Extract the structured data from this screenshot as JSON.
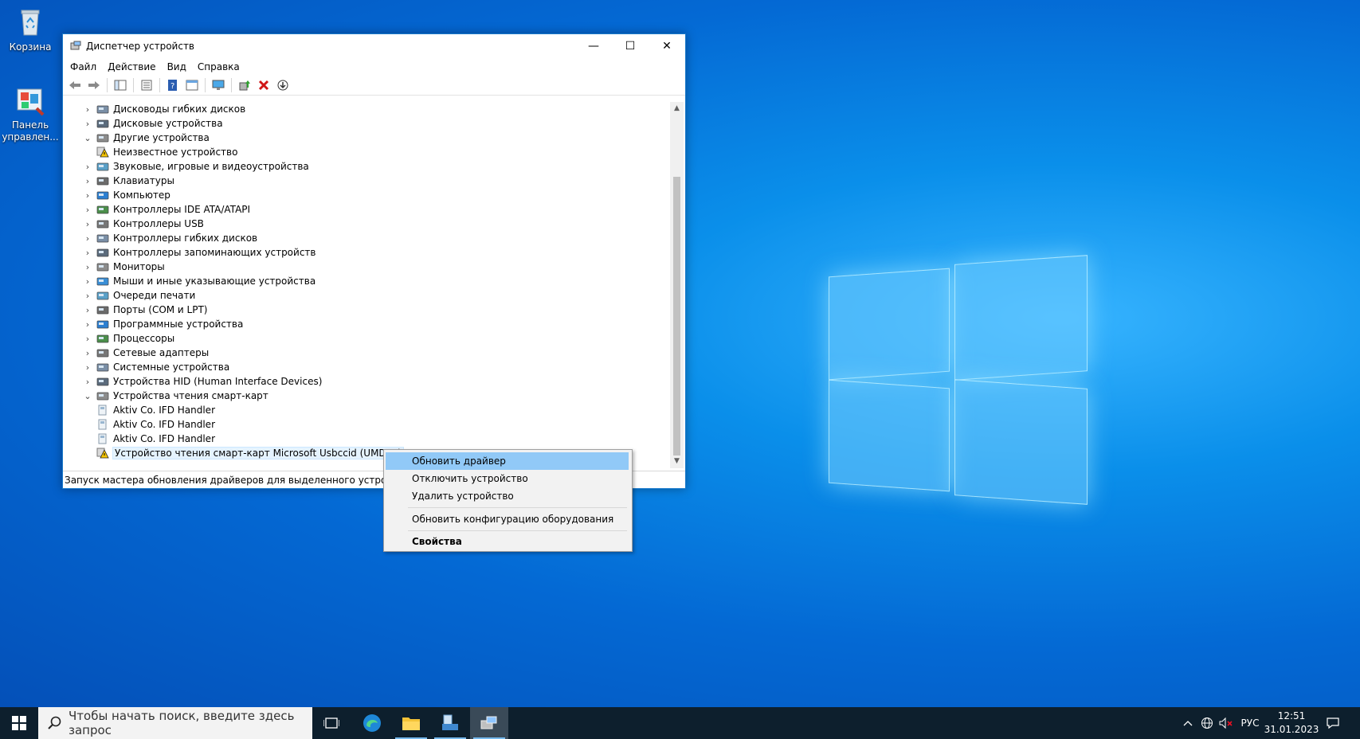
{
  "desktop": {
    "icons": [
      {
        "label": "Корзина"
      },
      {
        "label": "Панель управлен..."
      }
    ]
  },
  "window": {
    "title": "Диспетчер устройств",
    "controls": {
      "minimize": "—",
      "maximize": "☐",
      "close": "✕"
    },
    "menu": [
      "Файл",
      "Действие",
      "Вид",
      "Справка"
    ],
    "tree": [
      {
        "label": "Дисководы гибких дисков",
        "expander": "›",
        "level": 0
      },
      {
        "label": "Дисковые устройства",
        "expander": "›",
        "level": 0
      },
      {
        "label": "Другие устройства",
        "expander": "⌄",
        "level": 0
      },
      {
        "label": "Неизвестное устройство",
        "expander": "",
        "level": 1
      },
      {
        "label": "Звуковые, игровые и видеоустройства",
        "expander": "›",
        "level": 0
      },
      {
        "label": "Клавиатуры",
        "expander": "›",
        "level": 0
      },
      {
        "label": "Компьютер",
        "expander": "›",
        "level": 0
      },
      {
        "label": "Контроллеры IDE ATA/ATAPI",
        "expander": "›",
        "level": 0
      },
      {
        "label": "Контроллеры USB",
        "expander": "›",
        "level": 0
      },
      {
        "label": "Контроллеры гибких дисков",
        "expander": "›",
        "level": 0
      },
      {
        "label": "Контроллеры запоминающих устройств",
        "expander": "›",
        "level": 0
      },
      {
        "label": "Мониторы",
        "expander": "›",
        "level": 0
      },
      {
        "label": "Мыши и иные указывающие устройства",
        "expander": "›",
        "level": 0
      },
      {
        "label": "Очереди печати",
        "expander": "›",
        "level": 0
      },
      {
        "label": "Порты (COM и LPT)",
        "expander": "›",
        "level": 0
      },
      {
        "label": "Программные устройства",
        "expander": "›",
        "level": 0
      },
      {
        "label": "Процессоры",
        "expander": "›",
        "level": 0
      },
      {
        "label": "Сетевые адаптеры",
        "expander": "›",
        "level": 0
      },
      {
        "label": "Системные устройства",
        "expander": "›",
        "level": 0
      },
      {
        "label": "Устройства HID (Human Interface Devices)",
        "expander": "›",
        "level": 0
      },
      {
        "label": "Устройства чтения смарт-карт",
        "expander": "⌄",
        "level": 0
      },
      {
        "label": "Aktiv Co. IFD Handler",
        "expander": "",
        "level": 1
      },
      {
        "label": "Aktiv Co. IFD Handler",
        "expander": "",
        "level": 1
      },
      {
        "label": "Aktiv Co. IFD Handler",
        "expander": "",
        "level": 1
      },
      {
        "label": "Устройство чтения смарт-карт Microsoft Usbccid (UMDF2)",
        "expander": "",
        "level": 1,
        "selected": true,
        "warning": true
      }
    ],
    "status": "Запуск мастера обновления драйверов для выделенного устройства."
  },
  "context_menu": {
    "items": [
      {
        "label": "Обновить драйвер",
        "highlighted": true
      },
      {
        "label": "Отключить устройство"
      },
      {
        "label": "Удалить устройство"
      },
      {
        "label": "Обновить конфигурацию оборудования"
      },
      {
        "label": "Свойства",
        "bold": true
      }
    ]
  },
  "taskbar": {
    "search_placeholder": "Чтобы начать поиск, введите здесь запрос",
    "language": "РУС",
    "time": "12:51",
    "date": "31.01.2023"
  },
  "colors": {
    "accent": "#0078d7",
    "menu_highlight": "#91c9f7",
    "taskbar": "#0d1f2d"
  }
}
